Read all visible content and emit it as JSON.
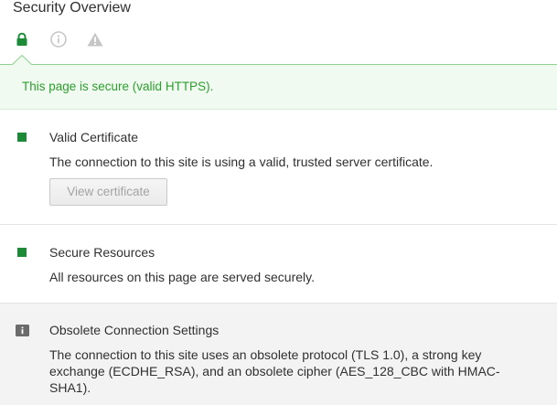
{
  "header": {
    "title": "Security Overview"
  },
  "tabs": [
    {
      "icon": "lock-icon",
      "active": true
    },
    {
      "icon": "info-circle-icon",
      "active": false
    },
    {
      "icon": "warning-triangle-icon",
      "active": false
    }
  ],
  "banner": {
    "text": "This page is secure (valid HTTPS).",
    "color": "#2e9e2e"
  },
  "sections": [
    {
      "status": "secure",
      "status_color": "#1c8a36",
      "title": "Valid Certificate",
      "description": "The connection to this site is using a valid, trusted server certificate.",
      "button_label": "View certificate"
    },
    {
      "status": "secure",
      "status_color": "#1c8a36",
      "title": "Secure Resources",
      "description": "All resources on this page are served securely."
    },
    {
      "status": "info",
      "title": "Obsolete Connection Settings",
      "description": "The connection to this site uses an obsolete protocol (TLS 1.0), a strong key exchange (ECDHE_RSA), and an obsolete cipher (AES_128_CBC with HMAC-SHA1)."
    }
  ]
}
